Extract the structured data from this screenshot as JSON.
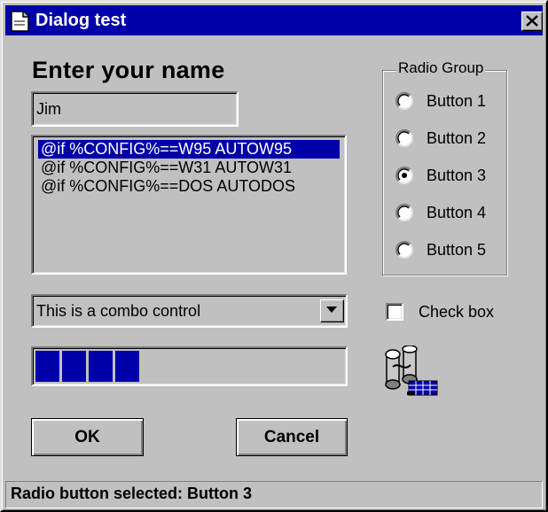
{
  "window": {
    "title": "Dialog test",
    "title_icon": "document-icon",
    "close_icon": "close-icon"
  },
  "colors": {
    "titlebar": "#0000a8",
    "face": "#c0c0c0",
    "selection": "#0000a8",
    "progress": "#0000a8"
  },
  "form": {
    "heading": "Enter your name",
    "name_value": "Jim"
  },
  "listbox": {
    "items": [
      "@if %CONFIG%==W95 AUTOW95",
      "@if %CONFIG%==W31 AUTOW31",
      "@if %CONFIG%==DOS AUTODOS"
    ],
    "selected_index": 0
  },
  "combo": {
    "value": "This is a combo control",
    "dropdown_icon": "chevron-down-icon"
  },
  "progress": {
    "value_fraction": 0.35,
    "filled_blocks": 4
  },
  "buttons": {
    "ok": "OK",
    "cancel": "Cancel"
  },
  "radio_group": {
    "label": "Radio Group",
    "options": [
      "Button 1",
      "Button 2",
      "Button 3",
      "Button 4",
      "Button 5"
    ],
    "selected_index": 2
  },
  "checkbox": {
    "label": "Check box",
    "checked": false
  },
  "animation": {
    "icon": "film-reel-icon"
  },
  "status": {
    "text": "Radio button selected: Button 3"
  }
}
